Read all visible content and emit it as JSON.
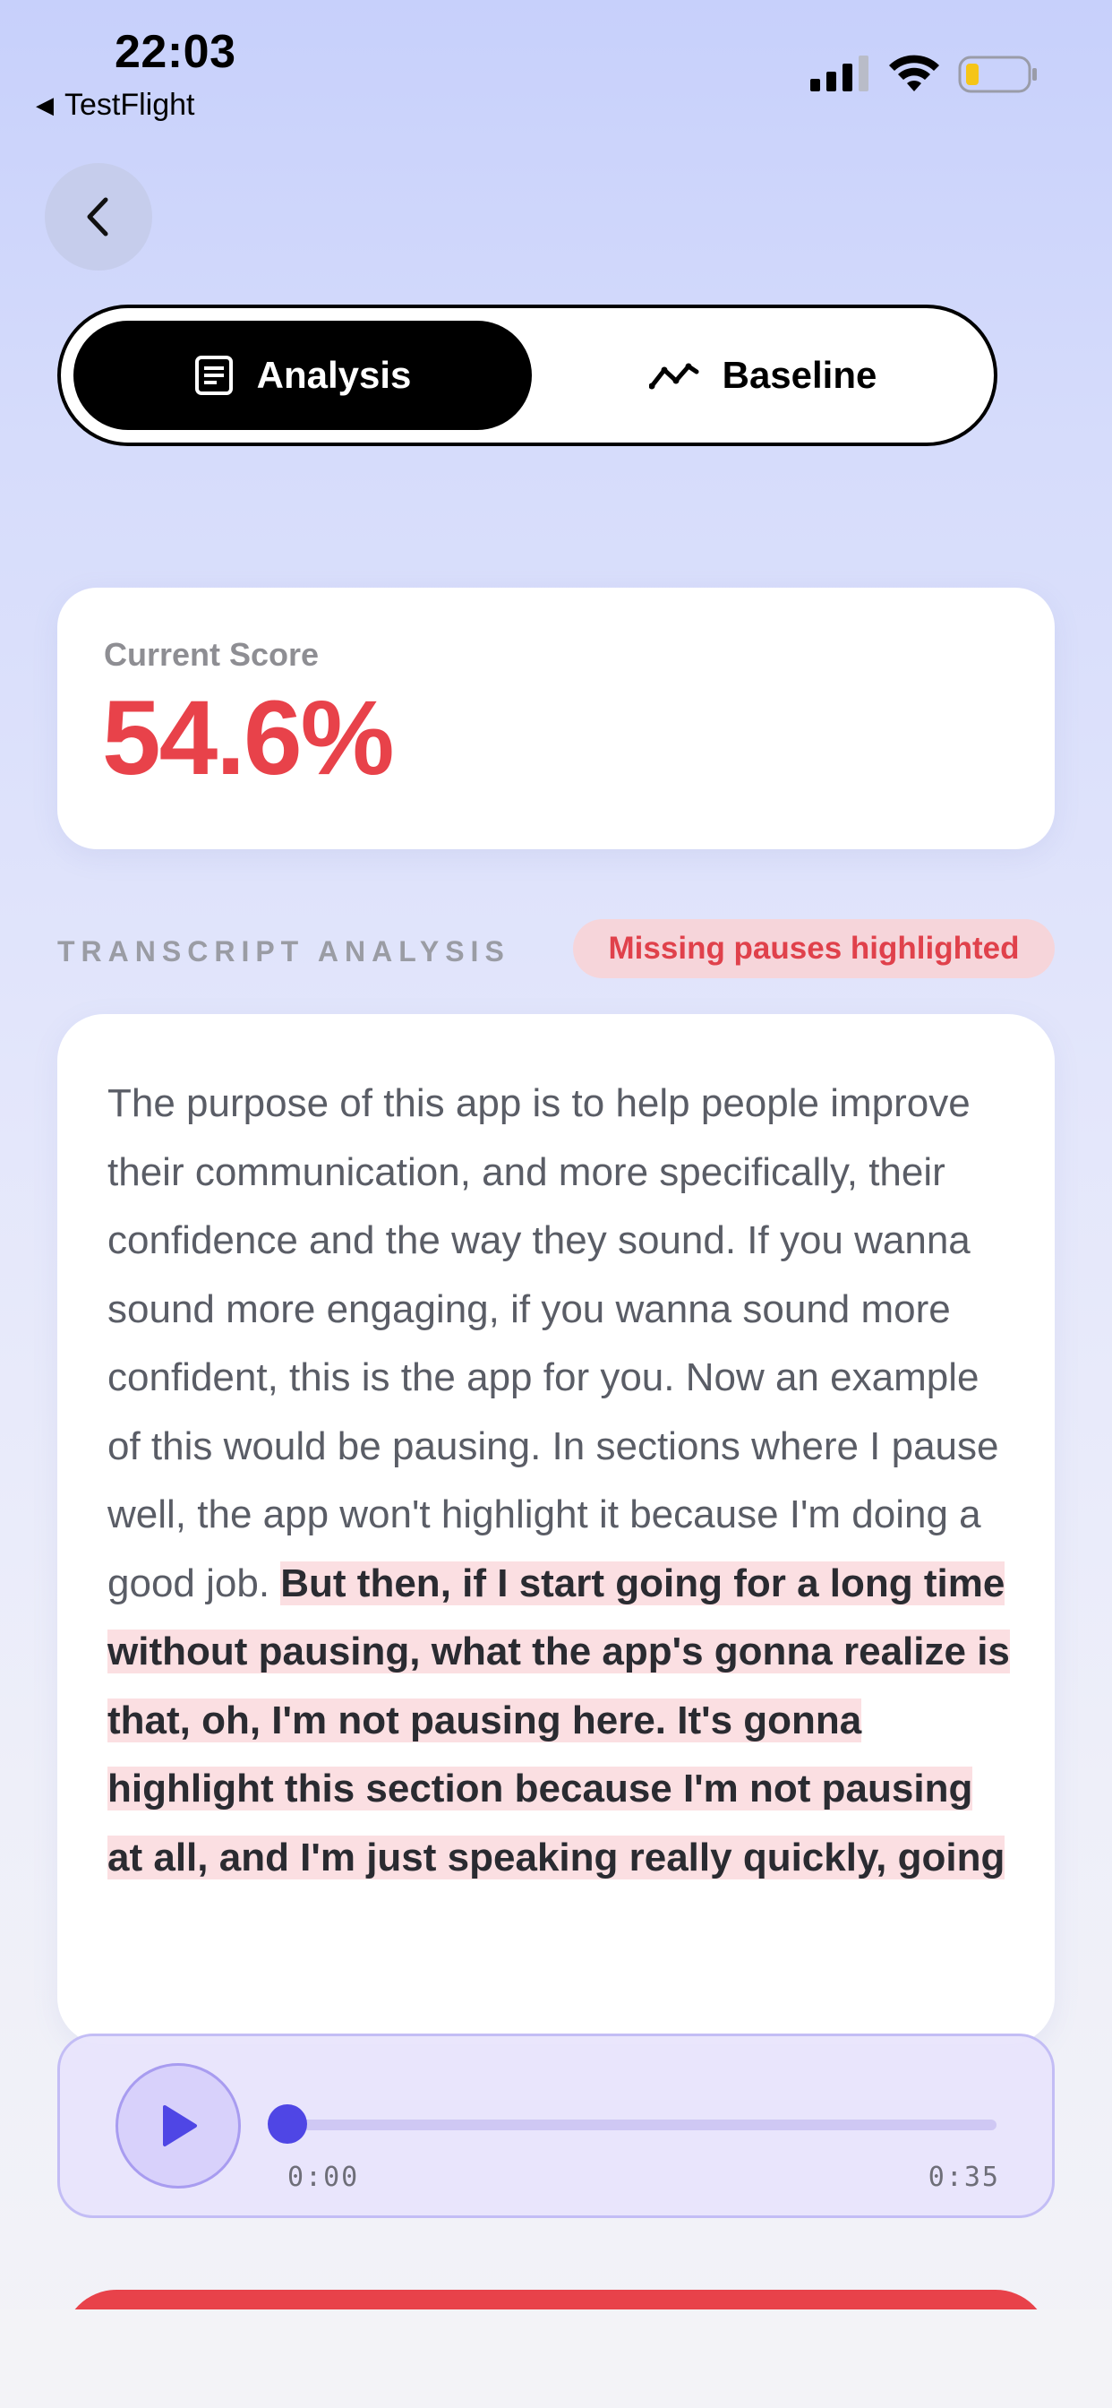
{
  "status_bar": {
    "time": "22:03",
    "back_app": "TestFlight"
  },
  "segmented_control": {
    "analysis_label": "Analysis",
    "baseline_label": "Baseline",
    "selected": "Analysis"
  },
  "score": {
    "label": "Current Score",
    "value": "54.6%"
  },
  "transcript": {
    "section_title": "TRANSCRIPT ANALYSIS",
    "badge": "Missing pauses highlighted",
    "plain_text": "The purpose of this app is to help people improve their communication, and more specifically, their confidence and the way they sound. If you wanna sound more engaging, if you wanna sound more confident, this is the app for you. Now an example of this would be pausing. In sections where I pause well, the app won't highlight it because I'm doing a good job. ",
    "highlighted_text": "But then, if I start going for a long time without pausing, what the app's gonna realize is that, oh, I'm not pausing here. It's gonna highlight this section because I'm not pausing at all, and I'm just speaking really quickly, going"
  },
  "player": {
    "current_time": "0:00",
    "duration": "0:35",
    "progress": 0
  },
  "colors": {
    "score_red": "#e8424a",
    "accent_indigo": "#4f46e5",
    "highlight_bg": "#fbdfe2"
  }
}
